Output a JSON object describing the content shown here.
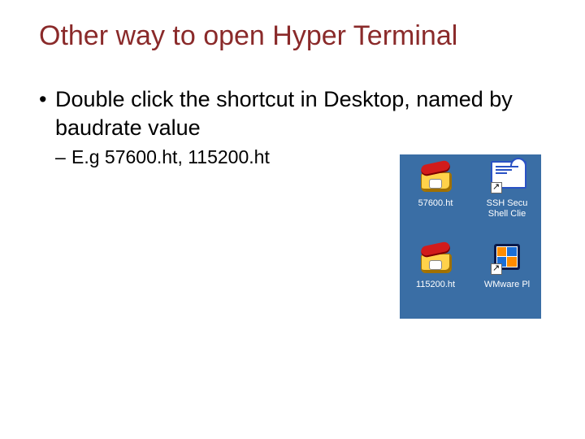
{
  "title": "Other way to open Hyper Terminal",
  "bullet": "Double click the shortcut in Desktop, named by baudrate value",
  "sub_bullet": "E.g 57600.ht, 115200.ht",
  "desktop": {
    "icons": [
      {
        "kind": "hyperterminal",
        "label": "57600.ht",
        "shortcut": false
      },
      {
        "kind": "ssh",
        "label": "SSH Secu\nShell Clie",
        "shortcut": true
      },
      {
        "kind": "hyperterminal",
        "label": "115200.ht",
        "shortcut": false
      },
      {
        "kind": "vmware",
        "label": "WMware Pl",
        "shortcut": true
      }
    ]
  }
}
